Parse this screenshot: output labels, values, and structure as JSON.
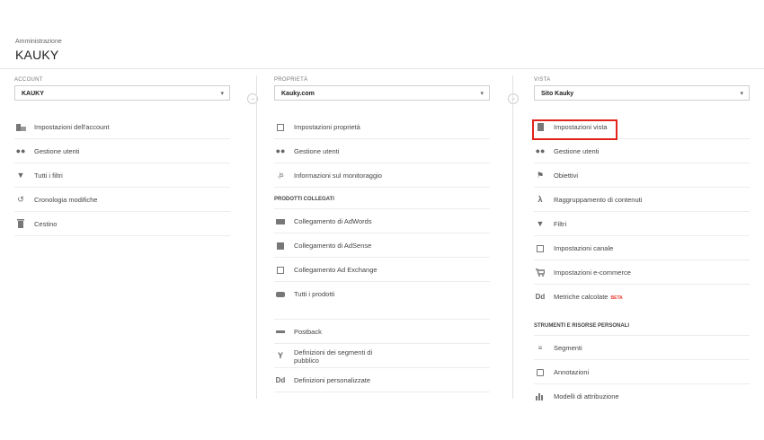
{
  "header": {
    "breadcrumb": "Amministrazione",
    "title": "KAUKY"
  },
  "account": {
    "label": "ACCOUNT",
    "selected": "KAUKY",
    "items": [
      {
        "label": "Impostazioni dell'account",
        "icon": "building-icon"
      },
      {
        "label": "Gestione utenti",
        "icon": "users-icon"
      },
      {
        "label": "Tutti i filtri",
        "icon": "filter-icon"
      },
      {
        "label": "Cronologia modifiche",
        "icon": "history-icon"
      },
      {
        "label": "Cestino",
        "icon": "trash-icon"
      }
    ]
  },
  "property": {
    "label": "PROPRIETÀ",
    "selected": "Kauky.com",
    "items": [
      {
        "label": "Impostazioni proprietà",
        "icon": "property-settings-icon"
      },
      {
        "label": "Gestione utenti",
        "icon": "users-icon"
      },
      {
        "label": "Informazioni sul monitoraggio",
        "icon": "js-icon"
      }
    ],
    "section_linked": "PRODOTTI COLLEGATI",
    "linked": [
      {
        "label": "Collegamento di AdWords",
        "icon": "adwords-icon"
      },
      {
        "label": "Collegamento di AdSense",
        "icon": "adsense-icon"
      },
      {
        "label": "Collegamento Ad Exchange",
        "icon": "adexchange-icon"
      },
      {
        "label": "Tutti i prodotti",
        "icon": "link-icon"
      }
    ],
    "other": [
      {
        "label": "Postback",
        "icon": "postback-icon"
      },
      {
        "label": "Definizioni dei segmenti di pubblico",
        "icon": "fork-icon"
      },
      {
        "label": "Definizioni personalizzate",
        "icon": "dd-icon"
      }
    ]
  },
  "view": {
    "label": "VISTA",
    "selected": "Sito Kauky",
    "items": [
      {
        "label": "Impostazioni vista",
        "icon": "document-icon"
      },
      {
        "label": "Gestione utenti",
        "icon": "users-icon"
      },
      {
        "label": "Obiettivi",
        "icon": "flag-icon"
      },
      {
        "label": "Raggruppamento di contenuti",
        "icon": "grouping-icon"
      },
      {
        "label": "Filtri",
        "icon": "filter-icon"
      },
      {
        "label": "Impostazioni canale",
        "icon": "channel-icon"
      },
      {
        "label": "Impostazioni e-commerce",
        "icon": "cart-icon"
      },
      {
        "label": "Metriche calcolate",
        "icon": "dd-icon",
        "badge": "BETA"
      }
    ],
    "section_tools": "STRUMENTI E RISORSE PERSONALI",
    "tools": [
      {
        "label": "Segmenti",
        "icon": "segments-icon"
      },
      {
        "label": "Annotazioni",
        "icon": "comment-icon"
      },
      {
        "label": "Modelli di attribuzione",
        "icon": "bar-chart-icon"
      }
    ]
  },
  "colors": {
    "highlight": "#e2231a"
  }
}
